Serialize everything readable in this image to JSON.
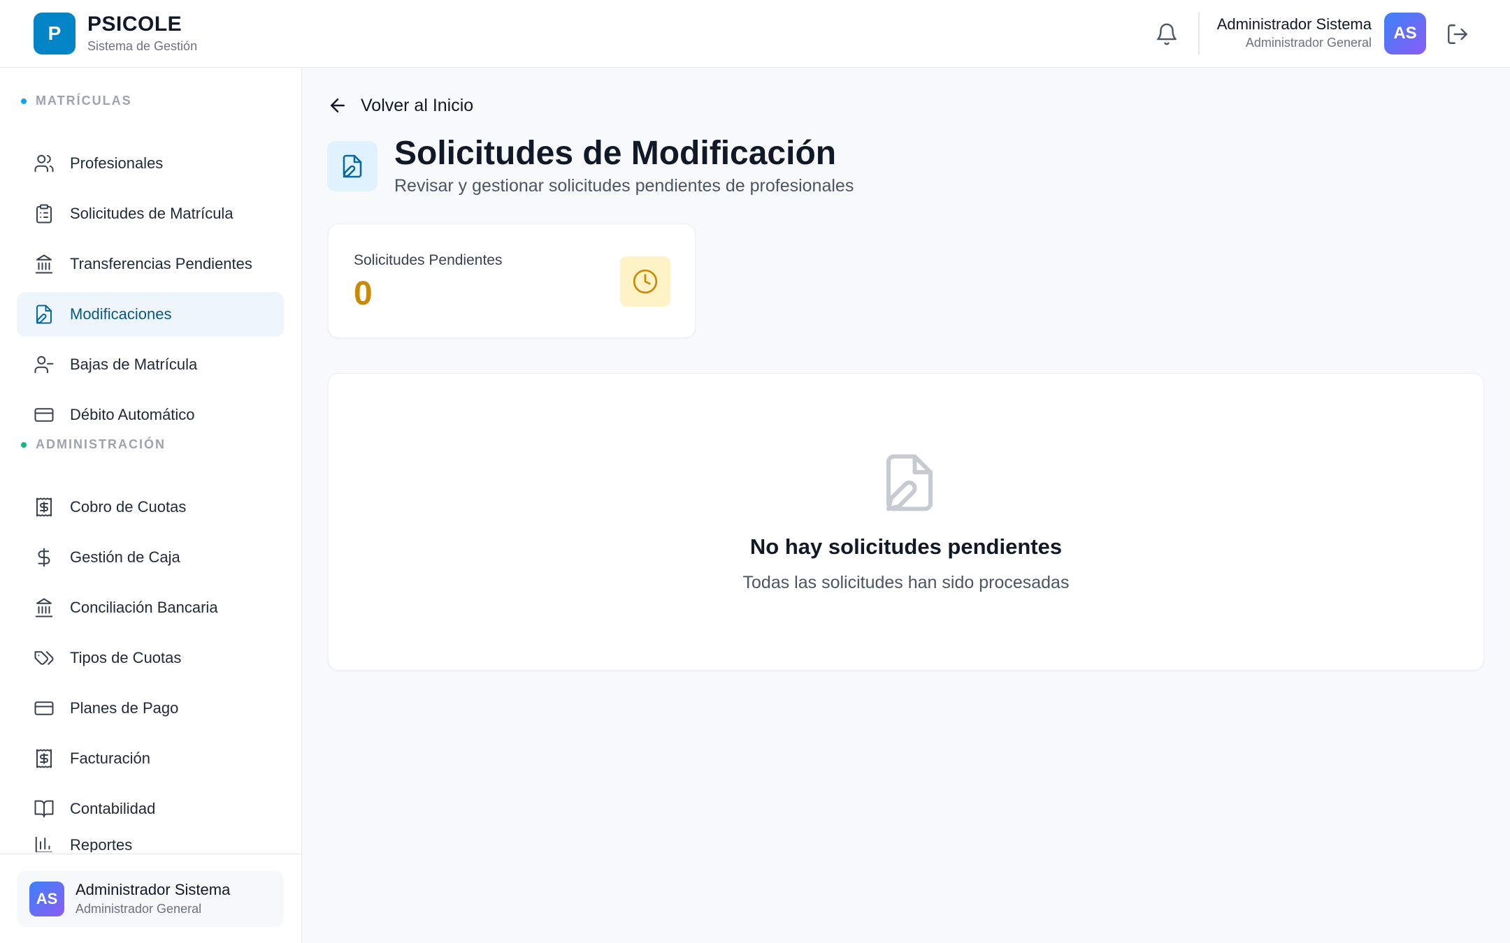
{
  "header": {
    "logo_letter": "P",
    "brand_name": "PSICOLE",
    "brand_sub": "Sistema de Gestión",
    "user_name": "Administrador Sistema",
    "user_role": "Administrador General",
    "avatar_initials": "AS"
  },
  "sidebar": {
    "sections": [
      {
        "label": "MATRÍCULAS",
        "dot_color": "#0ea5e9"
      },
      {
        "label": "ADMINISTRACIÓN",
        "dot_color": "#10b981"
      }
    ],
    "items": [
      {
        "label": "Profesionales",
        "icon": "users-icon"
      },
      {
        "label": "Solicitudes de Matrícula",
        "icon": "clipboard-icon"
      },
      {
        "label": "Transferencias Pendientes",
        "icon": "bank-icon"
      },
      {
        "label": "Modificaciones",
        "icon": "file-edit-icon",
        "active": true
      },
      {
        "label": "Bajas de Matrícula",
        "icon": "user-minus-icon"
      },
      {
        "label": "Débito Automático",
        "icon": "credit-card-icon"
      },
      {
        "label": "Cobro de Cuotas",
        "icon": "receipt-icon"
      },
      {
        "label": "Gestión de Caja",
        "icon": "dollar-icon"
      },
      {
        "label": "Conciliación Bancaria",
        "icon": "bank-icon"
      },
      {
        "label": "Tipos de Cuotas",
        "icon": "tags-icon"
      },
      {
        "label": "Planes de Pago",
        "icon": "credit-card-icon"
      },
      {
        "label": "Facturación",
        "icon": "receipt-icon"
      },
      {
        "label": "Contabilidad",
        "icon": "book-icon"
      },
      {
        "label": "Reportes",
        "icon": "bar-chart-icon"
      }
    ],
    "footer": {
      "avatar_initials": "AS",
      "name": "Administrador Sistema",
      "role": "Administrador General"
    }
  },
  "main": {
    "back_label": "Volver al Inicio",
    "title": "Solicitudes de Modificación",
    "subtitle": "Revisar y gestionar solicitudes pendientes de profesionales",
    "stat": {
      "label": "Solicitudes Pendientes",
      "value": "0",
      "icon": "clock-icon"
    },
    "empty": {
      "icon": "file-edit-icon",
      "title": "No hay solicitudes pendientes",
      "subtitle": "Todas las solicitudes han sido procesadas"
    }
  },
  "colors": {
    "brand": "#0284c7",
    "active_bg": "#eff6fb",
    "pending_value": "#ca8a04",
    "pending_icon_bg": "#fef3c7"
  }
}
